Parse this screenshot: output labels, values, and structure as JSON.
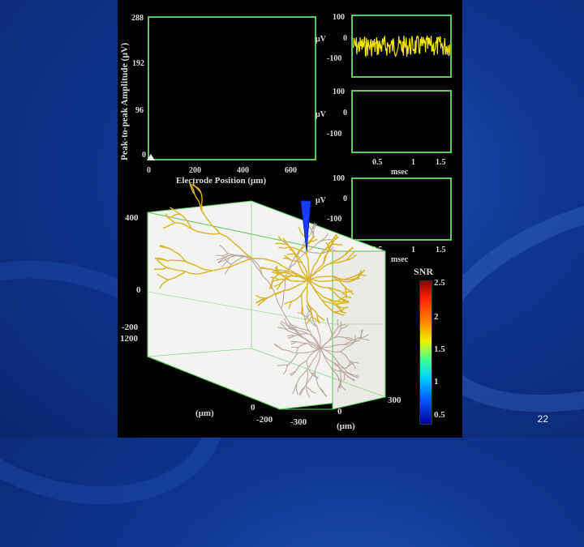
{
  "slide": {
    "page_number": "22"
  },
  "amplitude_plot": {
    "ylabel": "Peak-to-peak Amplitude (μV)",
    "yticks": [
      "288",
      "192",
      "96",
      "0"
    ],
    "xticks": [
      "0",
      "200",
      "400",
      "600"
    ],
    "xlabel": "Electrode Position (μm)"
  },
  "waveform_plots": [
    {
      "unit": "μV",
      "yticks": [
        "100",
        "0",
        "-100"
      ],
      "xticks": []
    },
    {
      "unit": "μV",
      "yticks": [
        "100",
        "0",
        "-100"
      ],
      "xticks": [
        "0.5",
        "1",
        "1.5"
      ],
      "xlabel": "msec"
    },
    {
      "unit": "μV",
      "yticks": [
        "100",
        "0",
        "-100"
      ],
      "xticks": [
        "0.5",
        "1",
        "1.5"
      ],
      "xlabel": "msec"
    }
  ],
  "neuron_volume": {
    "vertical_ticks": [
      "400",
      "0",
      "-200",
      "1200"
    ],
    "depth_label": "(μm)",
    "depth_ticks": [
      "0",
      "-200"
    ],
    "width_ticks": [
      "0",
      "-300",
      "300"
    ],
    "width_label": "(μm)"
  },
  "colorbar": {
    "title": "SNR",
    "ticks": [
      "2.5",
      "2",
      "1.5",
      "1",
      "0.5"
    ]
  },
  "colors": {
    "slide_bg": "#0f3590",
    "axis_green": "#5fc85f",
    "trace_yellow": "#f2e600",
    "neuron_active": "#d9b42a",
    "neuron_inactive": "#bba9a0",
    "electrode_blue": "#1a3cff"
  }
}
